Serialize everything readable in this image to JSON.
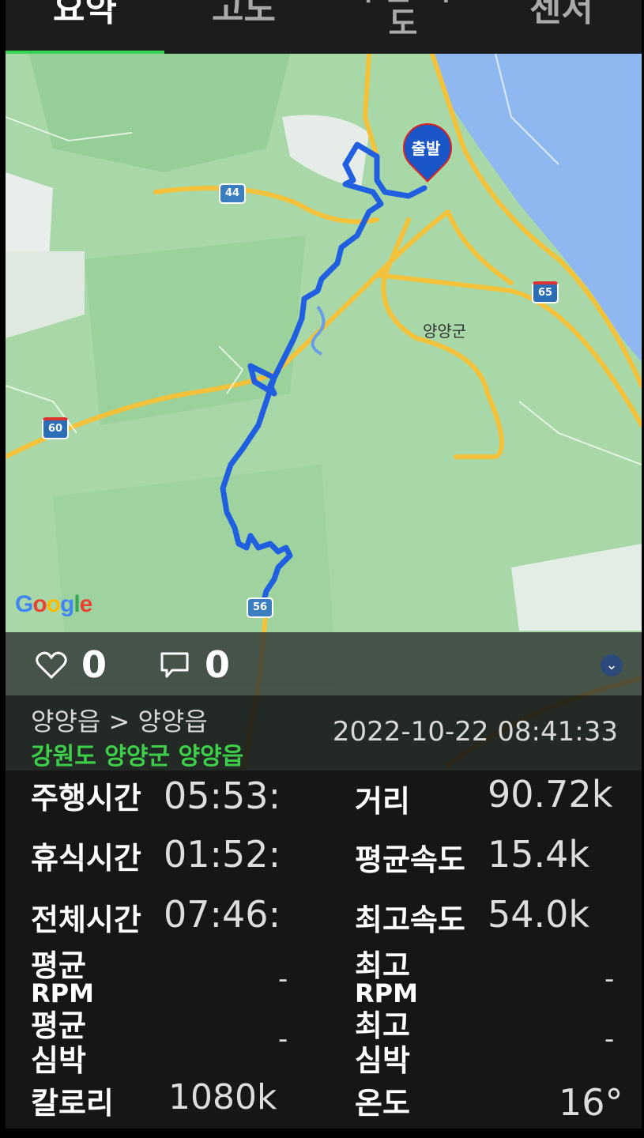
{
  "tabs": [
    "요약",
    "고도",
    "구간 속도",
    "센서"
  ],
  "map": {
    "start_label": "출발",
    "town_label": "양양군",
    "google_logo": "Google",
    "route_shields": [
      "44",
      "65",
      "60",
      "56"
    ],
    "route_color": "#1f5fe0"
  },
  "social": {
    "likes": "0",
    "comments": "0",
    "like_icon": "heart-icon",
    "comment_icon": "comment-icon"
  },
  "ride": {
    "route": "양양읍 > 양양읍",
    "region": "강원도 양양군 양양읍",
    "datetime": "2022-10-22 08:41:33"
  },
  "stats": {
    "ride_time_label": "주행시간",
    "ride_time_value": "05:53:",
    "rest_time_label": "휴식시간",
    "rest_time_value": "01:52:",
    "total_time_label": "전체시간",
    "total_time_value": "07:46:",
    "distance_label": "거리",
    "distance_value": "90.72k",
    "avg_speed_label": "평균속도",
    "avg_speed_value": "15.4k",
    "max_speed_label": "최고속도",
    "max_speed_value": "54.0k",
    "avg_rpm_label_1": "평균",
    "avg_rpm_label_2": "RPM",
    "avg_rpm_value": "-",
    "max_rpm_label_1": "최고",
    "max_rpm_label_2": "RPM",
    "max_rpm_value": "-",
    "avg_hr_label_1": "평균",
    "avg_hr_label_2": "심박",
    "avg_hr_value": "-",
    "max_hr_label_1": "최고",
    "max_hr_label_2": "심박",
    "max_hr_value": "-",
    "calories_label": "칼로리",
    "calories_value": "1080k",
    "temperature_label": "온도",
    "temperature_value": "16°"
  }
}
